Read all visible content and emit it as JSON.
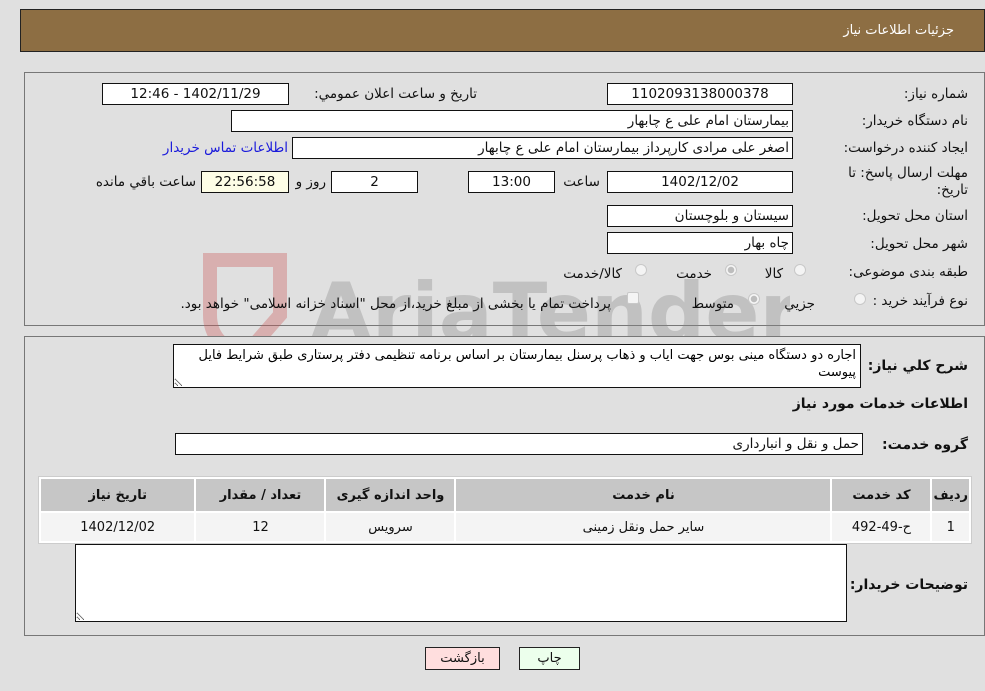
{
  "header": {
    "title": "جزئیات اطلاعات نیاز"
  },
  "form": {
    "need_number": {
      "label": "شماره نیاز:",
      "value": "1102093138000378"
    },
    "announce_datetime": {
      "label": "تاریخ و ساعت اعلان عمومي:",
      "value": "1402/11/29 - 12:46"
    },
    "buyer_org": {
      "label": "نام دستگاه خريدار:",
      "value": "بیمارستان امام علی  ع  چابهار"
    },
    "requester": {
      "label": "ایجاد کننده درخواست:",
      "value": "اصغر علی مرادی کارپرداز بیمارستان امام علی  ع  چابهار"
    },
    "buyer_contact_link": "اطلاعات تماس خريدار",
    "deadline": {
      "label": "مهلت ارسال پاسخ: تا تاریخ:",
      "date": "1402/12/02",
      "time_label": "ساعت",
      "time": "13:00",
      "days": "2",
      "days_label": "روز و",
      "remaining": "22:56:58",
      "remaining_label": "ساعت باقي مانده"
    },
    "province": {
      "label": "استان محل تحویل:",
      "value": "سیستان و بلوچستان"
    },
    "city": {
      "label": "شهر محل تحویل:",
      "value": "چاه بهار"
    },
    "category": {
      "label": "طبقه بندی موضوعی:",
      "options": [
        {
          "label": "کالا",
          "checked": false
        },
        {
          "label": "خدمت",
          "checked": true
        },
        {
          "label": "کالا/خدمت",
          "checked": false
        }
      ]
    },
    "purchase_type": {
      "label": "نوع فرآيند خريد :",
      "options": [
        {
          "label": "جزيي",
          "checked": false
        },
        {
          "label": "متوسط",
          "checked": true
        }
      ],
      "treasury_note": "پرداخت تمام يا بخشی از مبلغ خريد،از محل \"اسناد خزانه اسلامی\" خواهد بود.",
      "treasury_checked": false
    }
  },
  "description": {
    "label": "شرح كلي نياز:",
    "value": "اجاره دو دستگاه مینی بوس جهت اياب و ذهاب پرسنل بيمارستان بر اساس برنامه تنظیمی دفتر پرستاری طبق شرايط فايل پيوست"
  },
  "services": {
    "section_title": "اطلاعات خدمات مورد نياز",
    "group_label": "گروه خدمت:",
    "group_value": "حمل و نقل و انبارداری",
    "columns": [
      "رديف",
      "كد خدمت",
      "نام خدمت",
      "واحد اندازه گيری",
      "تعداد / مقدار",
      "تاريخ نياز"
    ],
    "rows": [
      [
        "1",
        "ح-49-492",
        "ساير حمل ونقل زمينی",
        "سرويس",
        "12",
        "1402/12/02"
      ]
    ]
  },
  "buyer_notes": {
    "label": "توضيحات خريدار:",
    "value": ""
  },
  "buttons": {
    "print": "چاپ",
    "back": "بازگشت"
  },
  "watermark": "AriaTender.neT"
}
